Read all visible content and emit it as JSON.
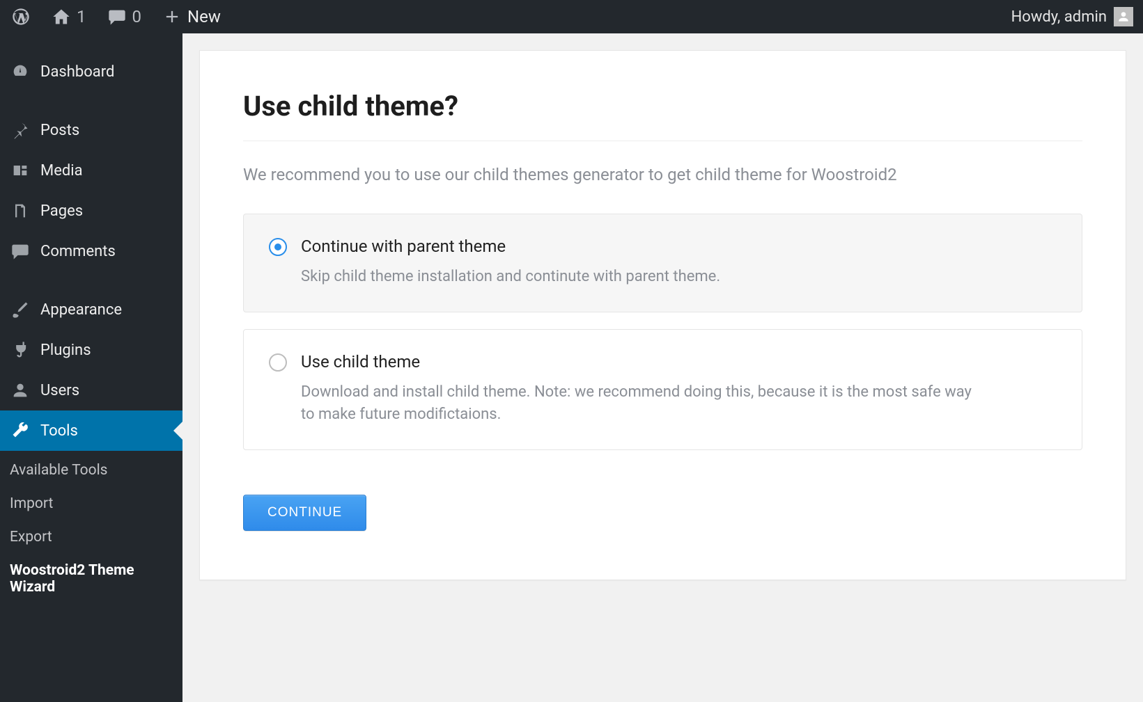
{
  "adminbar": {
    "site_count": "1",
    "comments_count": "0",
    "new_label": "New",
    "howdy": "Howdy, admin"
  },
  "sidebar": {
    "items": [
      {
        "label": "Dashboard",
        "icon": "dashboard"
      },
      {
        "label": "Posts",
        "icon": "pin"
      },
      {
        "label": "Media",
        "icon": "media"
      },
      {
        "label": "Pages",
        "icon": "pages"
      },
      {
        "label": "Comments",
        "icon": "comments"
      },
      {
        "label": "Appearance",
        "icon": "brush"
      },
      {
        "label": "Plugins",
        "icon": "plug"
      },
      {
        "label": "Users",
        "icon": "user"
      },
      {
        "label": "Tools",
        "icon": "wrench",
        "current": true
      }
    ],
    "submenu": [
      {
        "label": "Available Tools"
      },
      {
        "label": "Import"
      },
      {
        "label": "Export"
      },
      {
        "label": "Woostroid2 Theme Wizard",
        "active": true
      }
    ]
  },
  "panel": {
    "title": "Use child theme?",
    "subtitle": "We recommend you to use our child themes generator to get child theme for Woostroid2",
    "options": [
      {
        "title": "Continue with parent theme",
        "desc": "Skip child theme installation and continute with parent theme.",
        "selected": true
      },
      {
        "title": "Use child theme",
        "desc": "Download and install child theme. Note: we recommend doing this, because it is the most safe way to make future modifictaions.",
        "selected": false
      }
    ],
    "continue_label": "CONTINUE"
  }
}
